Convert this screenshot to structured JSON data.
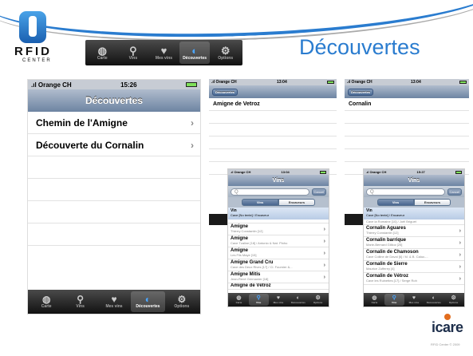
{
  "header": {
    "logo_text": "RFID",
    "logo_subtext": "CENTER",
    "title": "Découvertes",
    "tabs": [
      {
        "label": "Carte",
        "icon": "globe-icon"
      },
      {
        "label": "Vins",
        "icon": "search-icon"
      },
      {
        "label": "Mes vins",
        "icon": "heart-icon"
      },
      {
        "label": "Découvertes",
        "icon": "discover-icon",
        "active": true
      },
      {
        "label": "Options",
        "icon": "gear-icon"
      }
    ]
  },
  "main_phone": {
    "carrier": ".ıl Orange CH",
    "time": "15:26",
    "title": "Découvertes",
    "rows": [
      "Chemin de l'Amigne",
      "Découverte du Cornalin"
    ],
    "tabs": [
      "Carte",
      "Vins",
      "Mes vins",
      "Découvertes",
      "Options"
    ],
    "active_tab": "Découvertes"
  },
  "phone_amigne": {
    "carrier": ".ıl Orange CH",
    "time": "13:04",
    "back": "Découvertes",
    "row": "Amigne de Vetroz"
  },
  "phone_cornalin": {
    "carrier": ".ıl Orange CH",
    "time": "13:04",
    "back": "Découvertes",
    "row": "Cornalin"
  },
  "phone_vins_1": {
    "carrier": ".ıl Orange CH",
    "time": "13:04",
    "title": "Vins",
    "search_placeholder": "Q",
    "cancel": "Cancel",
    "seg": [
      "Vins",
      "Encaveurs"
    ],
    "header_title": "Vin",
    "header_sub": "Cave [No tente] / Encaveur",
    "items": [
      {
        "name": "Amigne",
        "sub": "Thierry Constantin [12]"
      },
      {
        "name": "Amigne",
        "sub": "Cave Tzaline [18] / Antonio & Nat. Pinho"
      },
      {
        "name": "Amigne",
        "sub": "Les Fils Maye [15]"
      },
      {
        "name": "Amigne Grand Cru",
        "sub": "Cave des Deux Rives [17] / Cl. Fournier &..."
      },
      {
        "name": "Amigne Mitis",
        "sub": "Jean-René Germanier [18]"
      },
      {
        "name": "Amigne de Vétroz",
        "sub": ""
      }
    ],
    "tabs": [
      "Carte",
      "Vins",
      "Mes vins",
      "Découvertes",
      "Options"
    ]
  },
  "phone_vins_2": {
    "carrier": ".ıl Orange CH",
    "time": "15:27",
    "title": "Vins",
    "search_placeholder": "Q",
    "cancel": "Cancel",
    "seg": [
      "Vins",
      "Encaveurs"
    ],
    "header_title": "Vin",
    "header_sub": "Cave [No tente] / Encaveur",
    "pre_sub": "Cave la Romaine [10] / Joël Briguet",
    "items": [
      {
        "name": "Cornalin Aguares",
        "sub": "Thierry Constantin [12]"
      },
      {
        "name": "Cornalin barrique",
        "sub": "Marie-Bernard Gillioz [25]"
      },
      {
        "name": "Cornalin de Chamoson",
        "sub": "Cave Colline de Daval [6] / M. & B. Caloz-..."
      },
      {
        "name": "Cornalin de Sierre",
        "sub": "Maurice Zufferey [4]"
      },
      {
        "name": "Cornalin de Vétroz",
        "sub": "Cave les Ruinettes [17] / Serge Roh"
      }
    ],
    "tabs": [
      "Carte",
      "Vins",
      "Mes vins",
      "Découvertes",
      "Options"
    ]
  },
  "footer": {
    "brand": "icare",
    "copyright": "RFID Center © 2009"
  },
  "colors": {
    "title_blue": "#2a7ccf",
    "nav_blue": "#6d84a2",
    "brand_orange": "#e26d1f"
  }
}
